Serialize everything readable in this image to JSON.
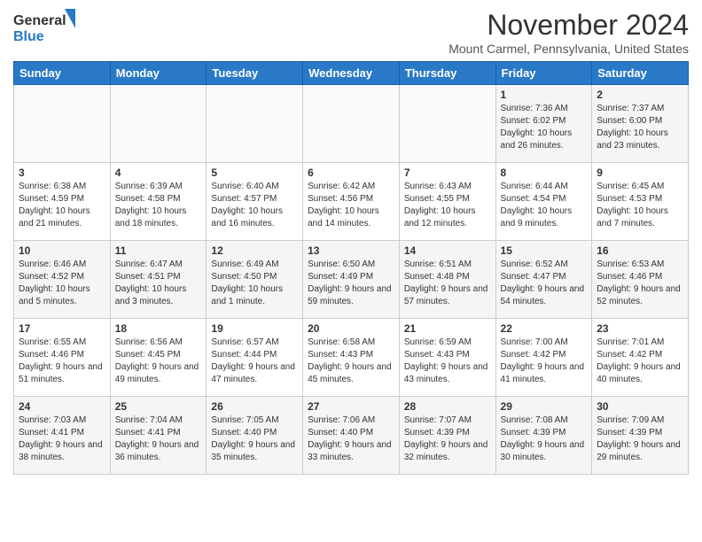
{
  "header": {
    "logo_general": "General",
    "logo_blue": "Blue",
    "month_title": "November 2024",
    "subtitle": "Mount Carmel, Pennsylvania, United States"
  },
  "calendar": {
    "days_of_week": [
      "Sunday",
      "Monday",
      "Tuesday",
      "Wednesday",
      "Thursday",
      "Friday",
      "Saturday"
    ],
    "weeks": [
      [
        {
          "day": "",
          "info": ""
        },
        {
          "day": "",
          "info": ""
        },
        {
          "day": "",
          "info": ""
        },
        {
          "day": "",
          "info": ""
        },
        {
          "day": "",
          "info": ""
        },
        {
          "day": "1",
          "info": "Sunrise: 7:36 AM\nSunset: 6:02 PM\nDaylight: 10 hours and 26 minutes."
        },
        {
          "day": "2",
          "info": "Sunrise: 7:37 AM\nSunset: 6:00 PM\nDaylight: 10 hours and 23 minutes."
        }
      ],
      [
        {
          "day": "3",
          "info": "Sunrise: 6:38 AM\nSunset: 4:59 PM\nDaylight: 10 hours and 21 minutes."
        },
        {
          "day": "4",
          "info": "Sunrise: 6:39 AM\nSunset: 4:58 PM\nDaylight: 10 hours and 18 minutes."
        },
        {
          "day": "5",
          "info": "Sunrise: 6:40 AM\nSunset: 4:57 PM\nDaylight: 10 hours and 16 minutes."
        },
        {
          "day": "6",
          "info": "Sunrise: 6:42 AM\nSunset: 4:56 PM\nDaylight: 10 hours and 14 minutes."
        },
        {
          "day": "7",
          "info": "Sunrise: 6:43 AM\nSunset: 4:55 PM\nDaylight: 10 hours and 12 minutes."
        },
        {
          "day": "8",
          "info": "Sunrise: 6:44 AM\nSunset: 4:54 PM\nDaylight: 10 hours and 9 minutes."
        },
        {
          "day": "9",
          "info": "Sunrise: 6:45 AM\nSunset: 4:53 PM\nDaylight: 10 hours and 7 minutes."
        }
      ],
      [
        {
          "day": "10",
          "info": "Sunrise: 6:46 AM\nSunset: 4:52 PM\nDaylight: 10 hours and 5 minutes."
        },
        {
          "day": "11",
          "info": "Sunrise: 6:47 AM\nSunset: 4:51 PM\nDaylight: 10 hours and 3 minutes."
        },
        {
          "day": "12",
          "info": "Sunrise: 6:49 AM\nSunset: 4:50 PM\nDaylight: 10 hours and 1 minute."
        },
        {
          "day": "13",
          "info": "Sunrise: 6:50 AM\nSunset: 4:49 PM\nDaylight: 9 hours and 59 minutes."
        },
        {
          "day": "14",
          "info": "Sunrise: 6:51 AM\nSunset: 4:48 PM\nDaylight: 9 hours and 57 minutes."
        },
        {
          "day": "15",
          "info": "Sunrise: 6:52 AM\nSunset: 4:47 PM\nDaylight: 9 hours and 54 minutes."
        },
        {
          "day": "16",
          "info": "Sunrise: 6:53 AM\nSunset: 4:46 PM\nDaylight: 9 hours and 52 minutes."
        }
      ],
      [
        {
          "day": "17",
          "info": "Sunrise: 6:55 AM\nSunset: 4:46 PM\nDaylight: 9 hours and 51 minutes."
        },
        {
          "day": "18",
          "info": "Sunrise: 6:56 AM\nSunset: 4:45 PM\nDaylight: 9 hours and 49 minutes."
        },
        {
          "day": "19",
          "info": "Sunrise: 6:57 AM\nSunset: 4:44 PM\nDaylight: 9 hours and 47 minutes."
        },
        {
          "day": "20",
          "info": "Sunrise: 6:58 AM\nSunset: 4:43 PM\nDaylight: 9 hours and 45 minutes."
        },
        {
          "day": "21",
          "info": "Sunrise: 6:59 AM\nSunset: 4:43 PM\nDaylight: 9 hours and 43 minutes."
        },
        {
          "day": "22",
          "info": "Sunrise: 7:00 AM\nSunset: 4:42 PM\nDaylight: 9 hours and 41 minutes."
        },
        {
          "day": "23",
          "info": "Sunrise: 7:01 AM\nSunset: 4:42 PM\nDaylight: 9 hours and 40 minutes."
        }
      ],
      [
        {
          "day": "24",
          "info": "Sunrise: 7:03 AM\nSunset: 4:41 PM\nDaylight: 9 hours and 38 minutes."
        },
        {
          "day": "25",
          "info": "Sunrise: 7:04 AM\nSunset: 4:41 PM\nDaylight: 9 hours and 36 minutes."
        },
        {
          "day": "26",
          "info": "Sunrise: 7:05 AM\nSunset: 4:40 PM\nDaylight: 9 hours and 35 minutes."
        },
        {
          "day": "27",
          "info": "Sunrise: 7:06 AM\nSunset: 4:40 PM\nDaylight: 9 hours and 33 minutes."
        },
        {
          "day": "28",
          "info": "Sunrise: 7:07 AM\nSunset: 4:39 PM\nDaylight: 9 hours and 32 minutes."
        },
        {
          "day": "29",
          "info": "Sunrise: 7:08 AM\nSunset: 4:39 PM\nDaylight: 9 hours and 30 minutes."
        },
        {
          "day": "30",
          "info": "Sunrise: 7:09 AM\nSunset: 4:39 PM\nDaylight: 9 hours and 29 minutes."
        }
      ]
    ]
  }
}
